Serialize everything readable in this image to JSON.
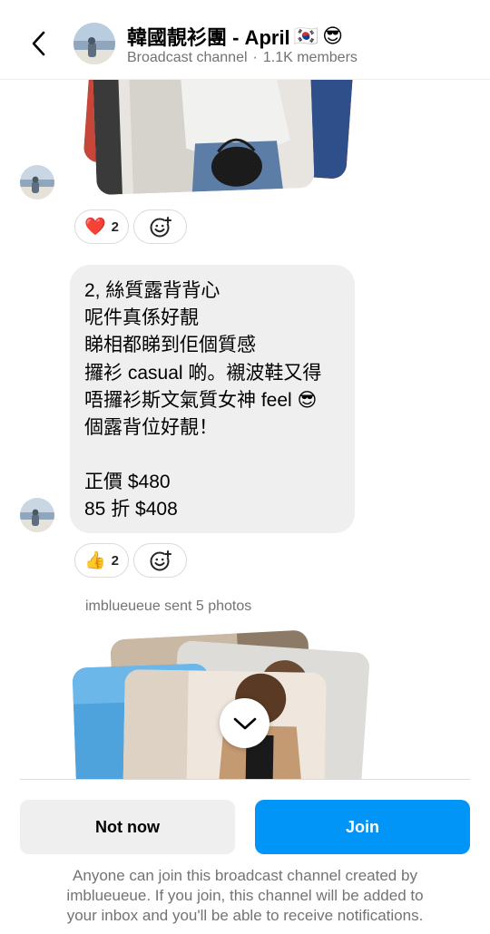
{
  "header": {
    "title": "韓國靚衫團 - April",
    "title_emojis": [
      "🇰🇷",
      "😎"
    ],
    "subtitle_type": "Broadcast channel",
    "subtitle_separator": "·",
    "members": "1.1K members",
    "back_icon": "chevron-left-icon",
    "avatar_icon": "channel-avatar"
  },
  "messages": [
    {
      "kind": "photo",
      "reactions": [
        {
          "emoji": "❤️",
          "count": "2"
        }
      ],
      "add_reaction_icon": "add-reaction-icon"
    },
    {
      "kind": "text",
      "lines": [
        "2, 絲質露背背心",
        "呢件真係好靚",
        "睇相都睇到佢個質感",
        "攞衫 casual 啲。襯波鞋又得",
        "唔攞衫斯文氣質女神 feel 😎",
        "個露背位好靚！",
        "",
        "正價 $480",
        "85 折 $408"
      ],
      "reactions": [
        {
          "emoji": "👍",
          "count": "2"
        }
      ],
      "add_reaction_icon": "add-reaction-icon"
    },
    {
      "kind": "photo_stack",
      "label": "imblueueue sent 5 photos",
      "expand_icon": "chevron-down-icon"
    }
  ],
  "footer": {
    "not_now_label": "Not now",
    "join_label": "Join",
    "note_lines": [
      "Anyone can join this broadcast channel created by",
      "imblueueue. If you join, this channel will be added to",
      "your inbox and you'll be able to receive notifications."
    ]
  },
  "colors": {
    "accent": "#0095f6",
    "bubble": "#efefef",
    "secondary_text": "#737373"
  }
}
